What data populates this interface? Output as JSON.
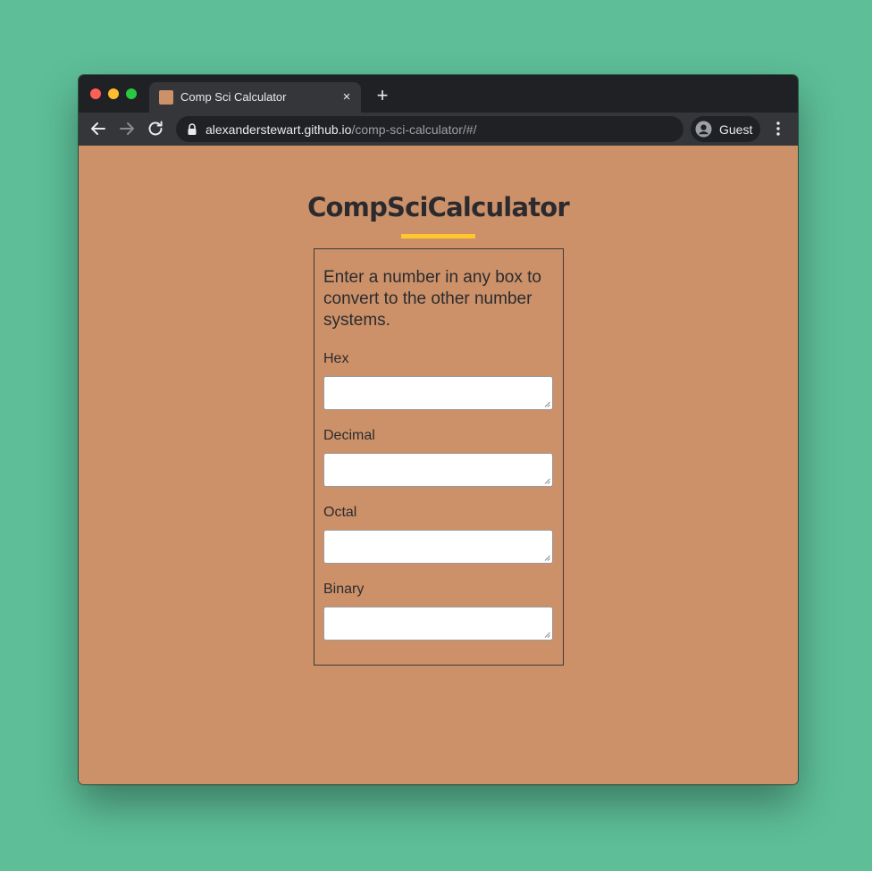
{
  "browser": {
    "tab_title": "Comp Sci Calculator",
    "url_host": "alexanderstewart.github.io",
    "url_path": "/comp-sci-calculator/#/",
    "profile_label": "Guest",
    "close_glyph": "×",
    "new_tab_glyph": "+"
  },
  "page": {
    "title": "CompSciCalculator",
    "instructions": "Enter a number in any box to convert to the other number systems.",
    "fields": [
      {
        "label": "Hex",
        "value": ""
      },
      {
        "label": "Decimal",
        "value": ""
      },
      {
        "label": "Octal",
        "value": ""
      },
      {
        "label": "Binary",
        "value": ""
      }
    ]
  },
  "colors": {
    "desktop": "#5dbe98",
    "page_background": "#cc9168",
    "accent_underline": "#ffc72c",
    "text": "#2b2b2f"
  },
  "icons": {
    "back": "arrow-left-icon",
    "forward": "arrow-right-icon",
    "reload": "reload-icon",
    "lock": "lock-icon",
    "profile": "account-circle-icon",
    "menu": "kebab-menu-icon"
  }
}
